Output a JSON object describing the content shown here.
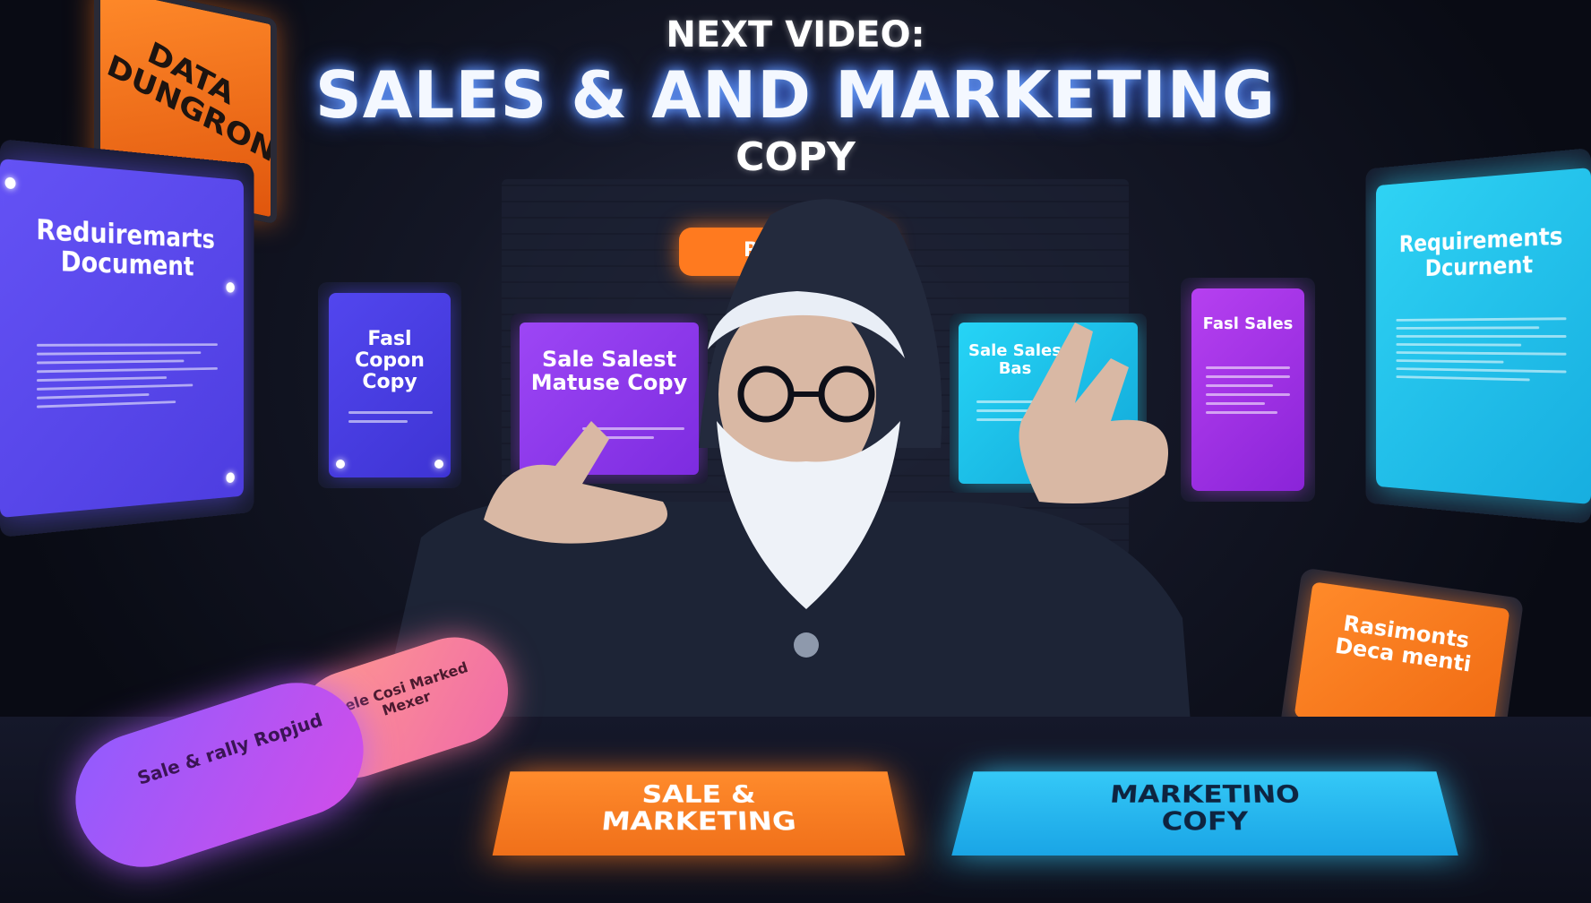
{
  "overlay": {
    "line1": "NEXT VIDEO:",
    "line2": "SALES & AND MARKETING",
    "line3": "COPY"
  },
  "signs": {
    "corner_sign": "DATA DUNGRON",
    "small_top_sign": "Relame",
    "right_stand_sign": "Rasimonts Deca menti"
  },
  "screens": {
    "left_large": "Reduiremarts Document",
    "left_small": "Fasl Copon Copy",
    "center_left": "Sale Salest Matuse Copy",
    "center_right": "Sale Sales Bas",
    "right_small": "Fasl Sales",
    "right_large": "Requirements Dcurnent"
  },
  "desk": {
    "scroll_front": "Sale & rally Ropjud",
    "scroll_back": "Sele Cosi Marked Mexer",
    "card_orange": "SALE & MARKETING",
    "card_blue": "MARKETINO COFY"
  },
  "colors": {
    "orange": "#ff7a1f",
    "violet": "#5a4cf0",
    "purple": "#9b3cf2",
    "cyan": "#1fc6ef",
    "pink": "#ef4fd6"
  }
}
